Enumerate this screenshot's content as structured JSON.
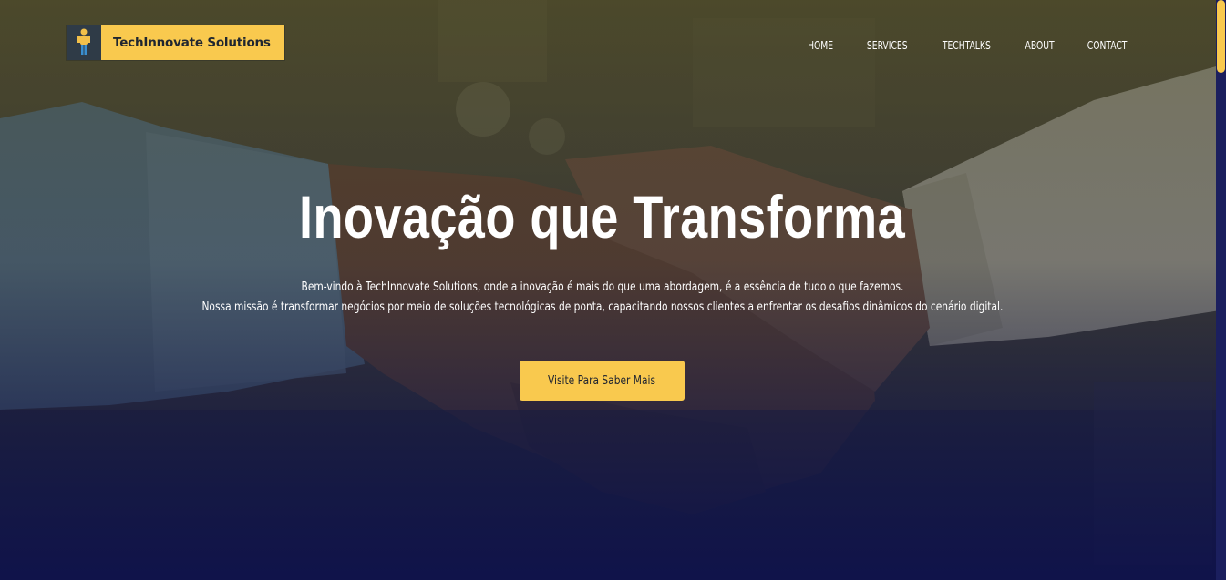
{
  "brand": {
    "name": "TechInnovate Solutions",
    "logo_icon": "robot-figure-icon",
    "accent_color": "#f9c94e"
  },
  "nav": {
    "items": [
      {
        "label": "HOME"
      },
      {
        "label": "SERVICES"
      },
      {
        "label": "TECHTALKS"
      },
      {
        "label": "ABOUT"
      },
      {
        "label": "CONTACT"
      }
    ]
  },
  "hero": {
    "title": "Inovação que Transforma",
    "text_line1": "Bem-vindo à TechInnovate Solutions, onde a inovação é mais do que uma abordagem, é a essência de tudo o que fazemos.",
    "text_line2": "Nossa missão é transformar negócios por meio de soluções tecnológicas de ponta, capacitando nossos clientes a enfrentar os desafios dinâmicos do cenário digital.",
    "cta_label": "Visite Para Saber Mais"
  }
}
